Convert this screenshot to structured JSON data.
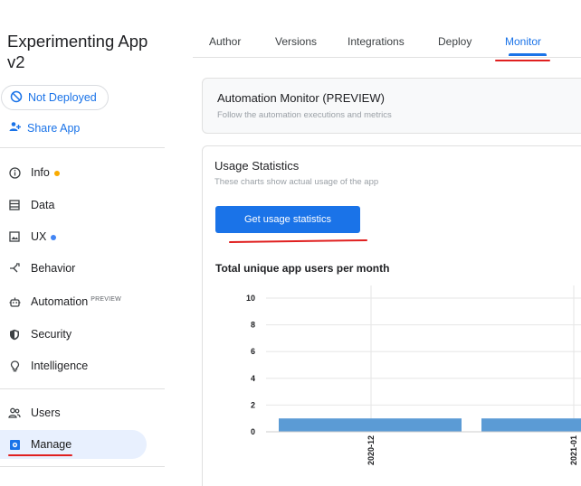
{
  "app": {
    "title": "Experimenting App v2"
  },
  "sidebar": {
    "deploy_status": "Not Deployed",
    "share_label": "Share App",
    "items": [
      {
        "label": "Info",
        "icon": "info-icon",
        "dot": "#f9ab00"
      },
      {
        "label": "Data",
        "icon": "table-icon"
      },
      {
        "label": "UX",
        "icon": "image-icon",
        "dot": "#4285f4"
      },
      {
        "label": "Behavior",
        "icon": "branch-icon"
      },
      {
        "label": "Automation",
        "icon": "robot-icon",
        "badge": "PREVIEW"
      },
      {
        "label": "Security",
        "icon": "shield-icon"
      },
      {
        "label": "Intelligence",
        "icon": "bulb-icon"
      },
      {
        "label": "Users",
        "icon": "users-icon"
      },
      {
        "label": "Manage",
        "icon": "manage-icon",
        "active": true
      }
    ]
  },
  "tabs": [
    {
      "label": "Author"
    },
    {
      "label": "Versions"
    },
    {
      "label": "Integrations"
    },
    {
      "label": "Deploy"
    },
    {
      "label": "Monitor",
      "active": true
    }
  ],
  "monitor_card": {
    "title": "Automation Monitor (PREVIEW)",
    "subtitle": "Follow the automation executions and metrics"
  },
  "usage_card": {
    "title": "Usage Statistics",
    "subtitle": "These charts show actual usage of the app",
    "button_label": "Get usage statistics"
  },
  "chart_data": {
    "type": "bar",
    "title": "Total unique app users per month",
    "categories": [
      "2020-12",
      "2021-01"
    ],
    "values": [
      1,
      1
    ],
    "yticks": [
      0,
      2,
      4,
      6,
      8,
      10
    ],
    "ylim": [
      0,
      10
    ],
    "grid": true,
    "bar_color": "#5b9bd5"
  },
  "colors": {
    "accent": "#1a73e8",
    "annotation": "#e02020"
  }
}
